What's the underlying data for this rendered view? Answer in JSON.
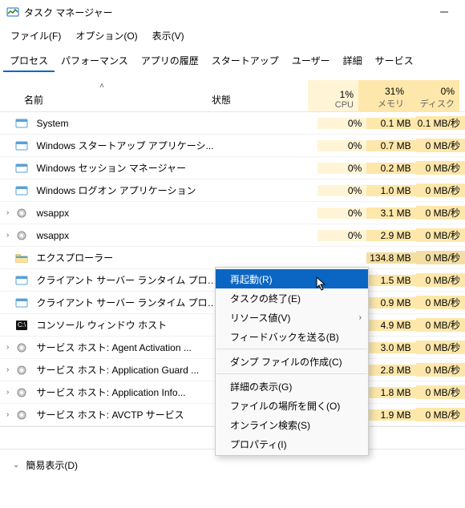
{
  "window": {
    "title": "タスク マネージャー"
  },
  "menubar": {
    "file": "ファイル(F)",
    "options": "オプション(O)",
    "view": "表示(V)"
  },
  "tabs": {
    "processes": "プロセス",
    "performance": "パフォーマンス",
    "apphistory": "アプリの履歴",
    "startup": "スタートアップ",
    "users": "ユーザー",
    "details": "詳細",
    "services": "サービス"
  },
  "columns": {
    "name": "名前",
    "status": "状態",
    "cpu": {
      "pct": "1%",
      "label": "CPU"
    },
    "mem": {
      "pct": "31%",
      "label": "メモリ"
    },
    "disk": {
      "pct": "0%",
      "label": "ディスク"
    }
  },
  "processes": [
    {
      "exp": "",
      "icon": "window",
      "name": "System",
      "cpu": "0%",
      "mem": "0.1 MB",
      "disk": "0.1 MB/秒"
    },
    {
      "exp": "",
      "icon": "window",
      "name": "Windows スタートアップ アプリケーシ...",
      "cpu": "0%",
      "mem": "0.7 MB",
      "disk": "0 MB/秒"
    },
    {
      "exp": "",
      "icon": "window",
      "name": "Windows セッション マネージャー",
      "cpu": "0%",
      "mem": "0.2 MB",
      "disk": "0 MB/秒"
    },
    {
      "exp": "",
      "icon": "window",
      "name": "Windows ログオン アプリケーション",
      "cpu": "0%",
      "mem": "1.0 MB",
      "disk": "0 MB/秒"
    },
    {
      "exp": "›",
      "icon": "gear",
      "name": "wsappx",
      "cpu": "0%",
      "mem": "3.1 MB",
      "disk": "0 MB/秒"
    },
    {
      "exp": "›",
      "icon": "gear",
      "name": "wsappx",
      "cpu": "0%",
      "mem": "2.9 MB",
      "disk": "0 MB/秒"
    },
    {
      "exp": "",
      "icon": "folder",
      "name": "エクスプローラー",
      "cpu": "",
      "mem": "134.8 MB",
      "disk": "0 MB/秒",
      "selected": true
    },
    {
      "exp": "",
      "icon": "window",
      "name": "クライアント サーバー ランタイム プロセス",
      "cpu": "0%",
      "mem": "1.5 MB",
      "disk": "0 MB/秒"
    },
    {
      "exp": "",
      "icon": "window",
      "name": "クライアント サーバー ランタイム プロセス",
      "cpu": "0%",
      "mem": "0.9 MB",
      "disk": "0 MB/秒"
    },
    {
      "exp": "",
      "icon": "console",
      "name": "コンソール ウィンドウ ホスト",
      "cpu": "0%",
      "mem": "4.9 MB",
      "disk": "0 MB/秒"
    },
    {
      "exp": "›",
      "icon": "gear",
      "name": "サービス ホスト: Agent Activation ...",
      "cpu": "",
      "mem": "3.0 MB",
      "disk": "0 MB/秒"
    },
    {
      "exp": "›",
      "icon": "gear",
      "name": "サービス ホスト: Application Guard ...",
      "cpu": "",
      "mem": "2.8 MB",
      "disk": "0 MB/秒"
    },
    {
      "exp": "›",
      "icon": "gear",
      "name": "サービス ホスト: Application Info...",
      "cpu": "",
      "mem": "1.8 MB",
      "disk": "0 MB/秒"
    },
    {
      "exp": "›",
      "icon": "gear",
      "name": "サービス ホスト: AVCTP サービス",
      "cpu": "",
      "mem": "1.9 MB",
      "disk": "0 MB/秒"
    }
  ],
  "context_menu": {
    "restart": "再起動(R)",
    "end": "タスクの終了(E)",
    "resources": "リソース値(V)",
    "feedback": "フィードバックを送る(B)",
    "dump": "ダンプ ファイルの作成(C)",
    "details": "詳細の表示(G)",
    "open_loc": "ファイルの場所を開く(O)",
    "online": "オンライン検索(S)",
    "properties": "プロパティ(I)"
  },
  "footer": {
    "simple": "簡易表示(D)"
  }
}
